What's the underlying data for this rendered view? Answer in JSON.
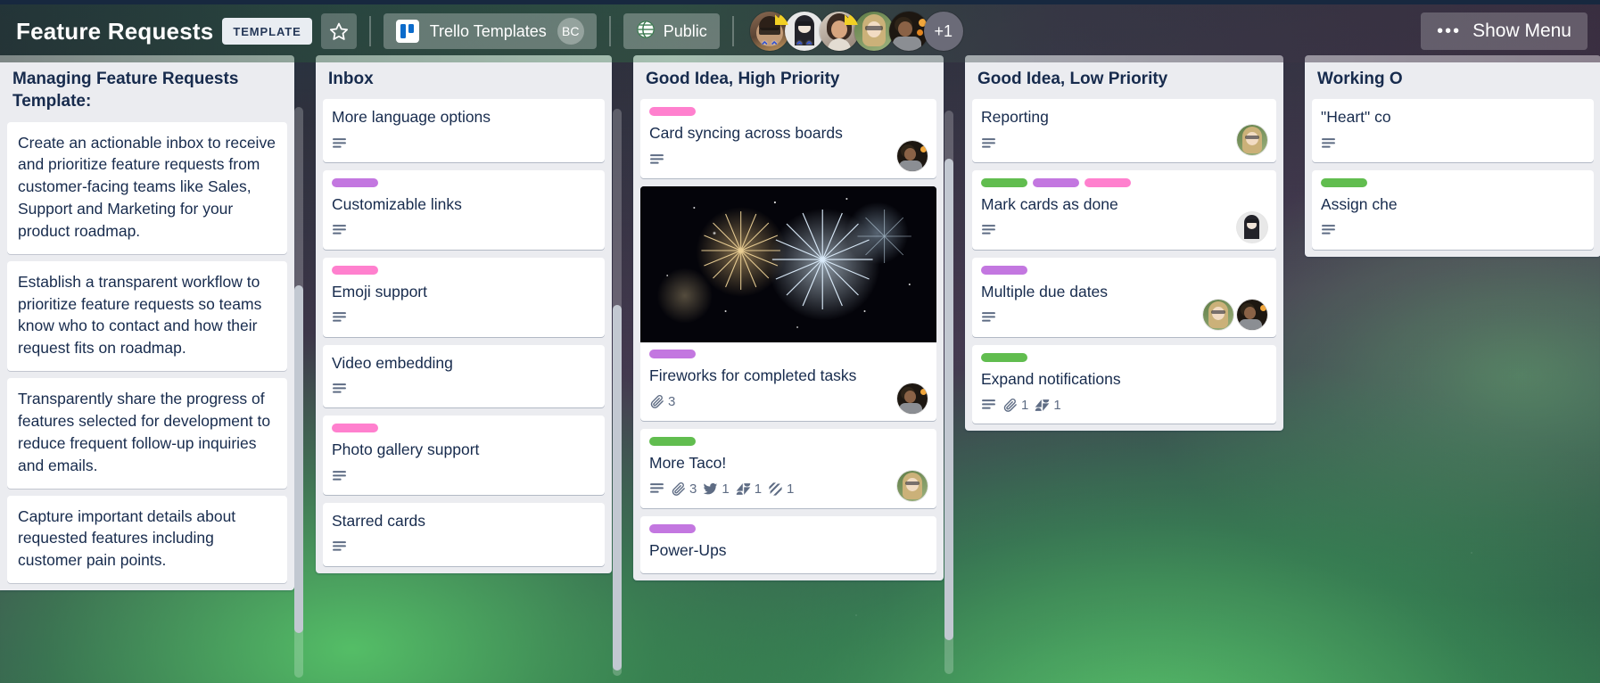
{
  "topbar": {
    "board_title": "Feature Requests",
    "template_badge": "TEMPLATE",
    "star_icon": "star-icon",
    "workspace": {
      "name": "Trello Templates",
      "logo_icon": "trello-logo-icon",
      "avatar_initials": "BC"
    },
    "visibility": {
      "label": "Public",
      "icon": "globe-icon"
    },
    "members_overflow": "+1",
    "show_menu": {
      "label": "Show Menu",
      "icon": "ellipsis-icon"
    }
  },
  "lists": [
    {
      "title": "Managing Feature Requests Template:",
      "cards": [
        {
          "text": "Create an actionable inbox to receive and prioritize feature requests from customer-facing teams like Sales, Support and Marketing for your product roadmap."
        },
        {
          "text": "Establish a transparent workflow to prioritize feature requests so teams know who to contact and how their request fits on roadmap."
        },
        {
          "text": "Transparently share the progress of features selected for development to reduce frequent follow-up inquiries and emails."
        },
        {
          "text": "Capture important details about requested features including customer pain points."
        }
      ]
    },
    {
      "title": "Inbox",
      "cards": [
        {
          "title": "More language options",
          "labels": [],
          "badges": [
            {
              "icon": "description-icon"
            }
          ]
        },
        {
          "title": "Customizable links",
          "labels": [
            "#c377e0"
          ],
          "badges": [
            {
              "icon": "description-icon"
            }
          ]
        },
        {
          "title": "Emoji support",
          "labels": [
            "#ff80ce"
          ],
          "badges": [
            {
              "icon": "description-icon"
            }
          ]
        },
        {
          "title": "Video embedding",
          "labels": [],
          "badges": [
            {
              "icon": "description-icon"
            }
          ]
        },
        {
          "title": "Photo gallery support",
          "labels": [
            "#ff80ce"
          ],
          "badges": [
            {
              "icon": "description-icon"
            }
          ]
        },
        {
          "title": "Starred cards",
          "labels": [],
          "badges": [
            {
              "icon": "description-icon"
            }
          ]
        }
      ]
    },
    {
      "title": "Good Idea, High Priority",
      "cards": [
        {
          "title": "Card syncing across boards",
          "labels": [
            "#ff80ce"
          ],
          "badges": [
            {
              "icon": "description-icon"
            }
          ],
          "avatars": 1
        },
        {
          "title": "Fireworks for completed tasks",
          "labels": [
            "#c377e0"
          ],
          "cover": "fireworks-image",
          "badges": [
            {
              "icon": "attachment-icon",
              "count": "3"
            }
          ],
          "avatars": 1
        },
        {
          "title": "More Taco!",
          "labels": [
            "#61bd4f"
          ],
          "badges": [
            {
              "icon": "description-icon"
            },
            {
              "icon": "attachment-icon",
              "count": "3"
            },
            {
              "icon": "twitter-icon",
              "count": "1"
            },
            {
              "icon": "zendesk-icon",
              "count": "1"
            },
            {
              "icon": "slack-icon",
              "count": "1"
            }
          ],
          "avatars": 1
        },
        {
          "title": "Power-Ups",
          "labels": [
            "#c377e0"
          ],
          "badges": []
        }
      ]
    },
    {
      "title": "Good Idea, Low Priority",
      "cards": [
        {
          "title": "Reporting",
          "labels": [],
          "badges": [
            {
              "icon": "description-icon"
            }
          ],
          "avatars": 1
        },
        {
          "title": "Mark cards as done",
          "labels": [
            "#61bd4f",
            "#c377e0",
            "#ff80ce"
          ],
          "badges": [
            {
              "icon": "description-icon"
            }
          ],
          "avatars": 1
        },
        {
          "title": "Multiple due dates",
          "labels": [
            "#c377e0"
          ],
          "badges": [
            {
              "icon": "description-icon"
            }
          ],
          "avatars": 2
        },
        {
          "title": "Expand notifications",
          "labels": [
            "#61bd4f"
          ],
          "badges": [
            {
              "icon": "description-icon"
            },
            {
              "icon": "attachment-icon",
              "count": "1"
            },
            {
              "icon": "zendesk-icon",
              "count": "1"
            }
          ]
        }
      ]
    },
    {
      "title": "Working O",
      "cards": [
        {
          "title": "\"Heart\" co",
          "labels": [],
          "badges": [
            {
              "icon": "description-icon"
            }
          ]
        },
        {
          "title": "Assign che",
          "labels": [
            "#61bd4f"
          ],
          "badges": [
            {
              "icon": "description-icon"
            }
          ]
        }
      ]
    }
  ],
  "colors": {
    "label_green": "#61bd4f",
    "label_purple": "#c377e0",
    "label_pink": "#ff80ce",
    "list_bg": "#ebecf0",
    "card_bg": "#ffffff",
    "text": "#172b4d",
    "muted_text": "#5e6c84"
  }
}
